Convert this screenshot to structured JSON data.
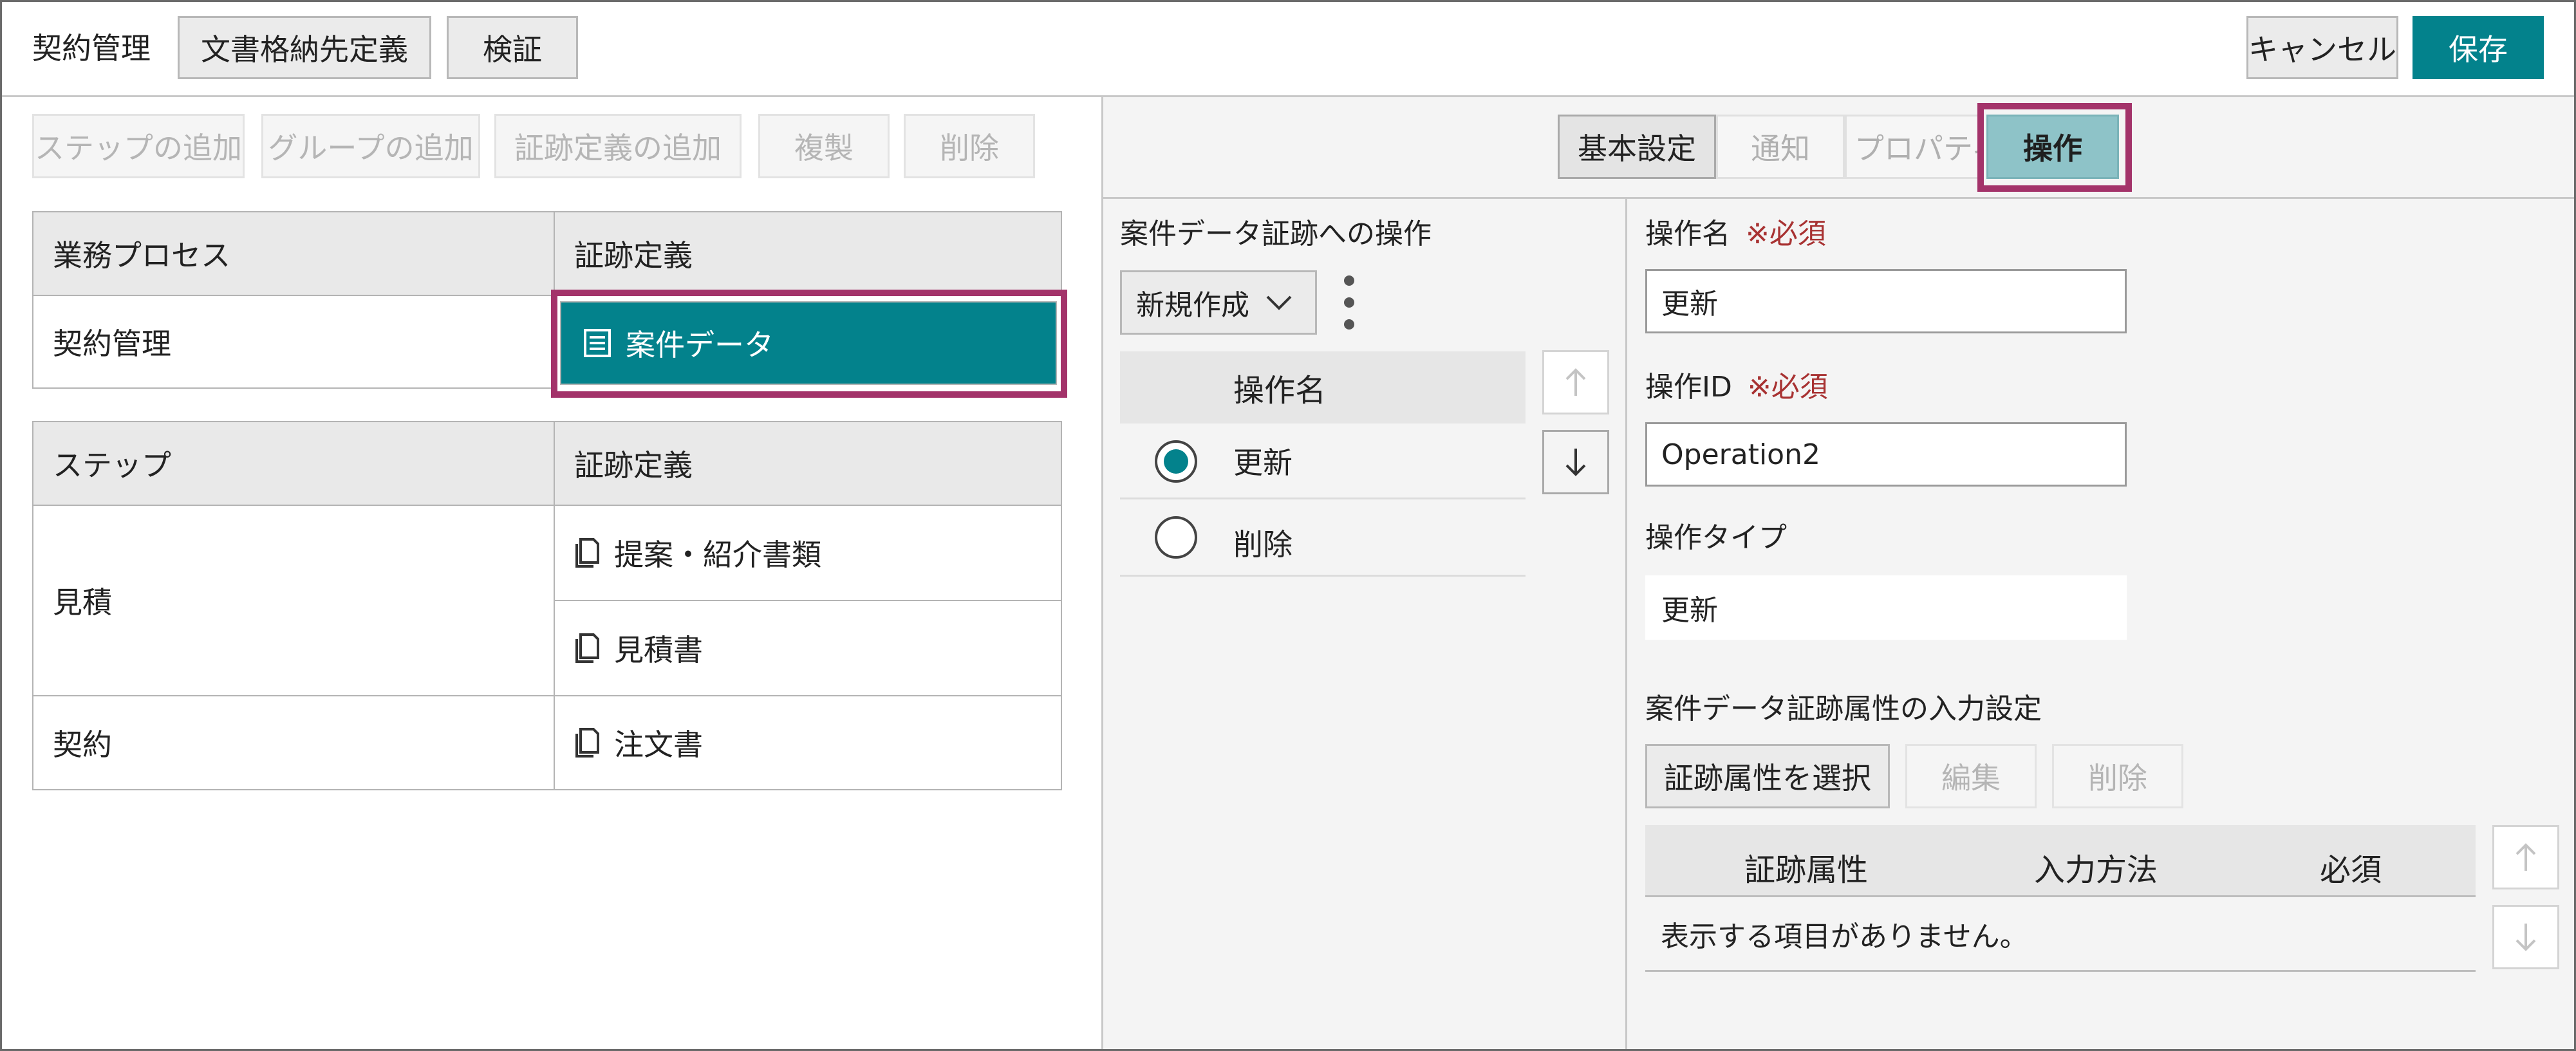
{
  "header": {
    "title": "契約管理",
    "doc_storage_button": "文書格納先定義",
    "verify_button": "検証",
    "cancel_button": "キャンセル",
    "save_button": "保存"
  },
  "left_toolbar": {
    "add_step": "ステップの追加",
    "add_group": "グループの追加",
    "add_evidence_def": "証跡定義の追加",
    "duplicate": "複製",
    "delete": "削除"
  },
  "process_table": {
    "headers": [
      "業務プロセス",
      "証跡定義"
    ],
    "process_name": "契約管理",
    "evidence": "案件データ"
  },
  "steps_table": {
    "headers": [
      "ステップ",
      "証跡定義"
    ],
    "rows": [
      {
        "step": "見積",
        "evidence": [
          "提案・紹介書類",
          "見積書"
        ]
      },
      {
        "step": "契約",
        "evidence": [
          "注文書"
        ]
      }
    ]
  },
  "tabs": {
    "basic": "基本設定",
    "notify": "通知",
    "property": "プロパティ",
    "operation": "操作",
    "active": "operation"
  },
  "operations_panel": {
    "title": "案件データ証跡への操作",
    "new_dropdown": "新規作成",
    "list_header": "操作名",
    "items": [
      {
        "name": "更新",
        "selected": true
      },
      {
        "name": "削除",
        "selected": false
      }
    ]
  },
  "detail": {
    "op_name_label": "操作名",
    "required_mark": "※必須",
    "op_name_value": "更新",
    "op_id_label": "操作ID",
    "op_id_value": "Operation2",
    "op_type_label": "操作タイプ",
    "op_type_value": "更新",
    "attr_section_label": "案件データ証跡属性の入力設定",
    "select_attr_button": "証跡属性を選択",
    "edit_button": "編集",
    "delete_button": "削除",
    "attr_table_headers": [
      "証跡属性",
      "入力方法",
      "必須"
    ],
    "empty_message": "表示する項目がありません。"
  },
  "colors": {
    "accent": "#03828c",
    "highlight": "#a3336a",
    "required": "#a83232"
  }
}
